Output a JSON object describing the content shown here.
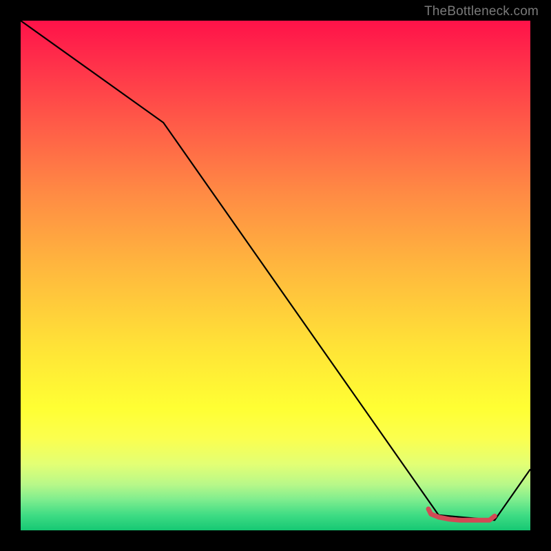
{
  "attribution": "TheBottleneck.com",
  "chart_data": {
    "type": "line",
    "title": "",
    "xlabel": "",
    "ylabel": "",
    "xlim": [
      0,
      100
    ],
    "ylim": [
      0,
      100
    ],
    "series": [
      {
        "name": "black-curve",
        "color": "#000000",
        "width": 2.2,
        "x": [
          0,
          28,
          82,
          93,
          100
        ],
        "y": [
          100,
          80,
          3,
          2,
          12
        ]
      },
      {
        "name": "red-flat-segment",
        "color": "#d24a55",
        "width": 7,
        "cap": "round",
        "x": [
          80,
          80.5,
          82,
          84,
          86,
          88,
          90,
          92,
          93
        ],
        "y": [
          4.2,
          3.2,
          2.6,
          2.2,
          2.0,
          2.0,
          2.0,
          2.0,
          2.8
        ]
      }
    ],
    "gradient_stops": [
      {
        "pos": 0.0,
        "color": "#ff1249"
      },
      {
        "pos": 0.2,
        "color": "#ff5a48"
      },
      {
        "pos": 0.48,
        "color": "#ffb63e"
      },
      {
        "pos": 0.76,
        "color": "#ffff33"
      },
      {
        "pos": 0.94,
        "color": "#7eed8e"
      },
      {
        "pos": 1.0,
        "color": "#16c873"
      }
    ]
  }
}
